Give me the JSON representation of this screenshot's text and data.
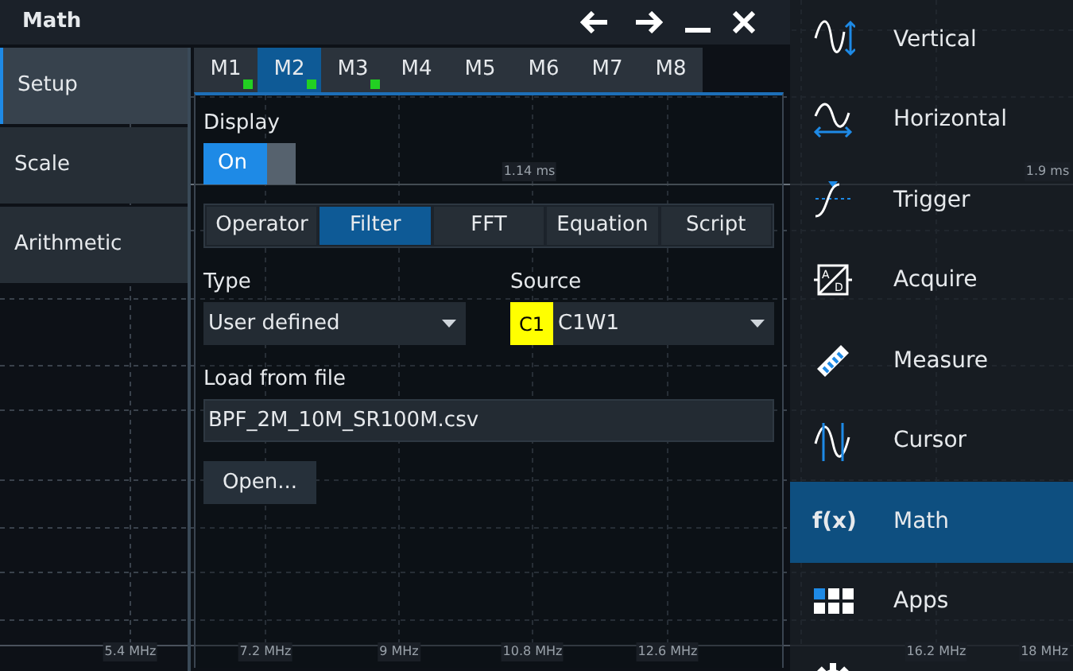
{
  "window": {
    "title": "Math"
  },
  "sidebar": {
    "items": [
      {
        "label": "Setup",
        "selected": true
      },
      {
        "label": "Scale",
        "selected": false
      },
      {
        "label": "Arithmetic",
        "selected": false
      }
    ]
  },
  "math_tabs": [
    {
      "label": "M1",
      "selected": false,
      "active": true
    },
    {
      "label": "M2",
      "selected": true,
      "active": true
    },
    {
      "label": "M3",
      "selected": false,
      "active": true
    },
    {
      "label": "M4",
      "selected": false,
      "active": false
    },
    {
      "label": "M5",
      "selected": false,
      "active": false
    },
    {
      "label": "M6",
      "selected": false,
      "active": false
    },
    {
      "label": "M7",
      "selected": false,
      "active": false
    },
    {
      "label": "M8",
      "selected": false,
      "active": false
    }
  ],
  "display": {
    "label": "Display",
    "toggle": {
      "label": "On",
      "on": true
    }
  },
  "mode_tabs": [
    {
      "label": "Operator",
      "selected": false
    },
    {
      "label": "Filter",
      "selected": true
    },
    {
      "label": "FFT",
      "selected": false
    },
    {
      "label": "Equation",
      "selected": false
    },
    {
      "label": "Script",
      "selected": false
    }
  ],
  "type": {
    "label": "Type",
    "value": "User defined"
  },
  "source": {
    "label": "Source",
    "badge": "C1",
    "color": "#ffff00",
    "value": "C1W1"
  },
  "load_from_file": {
    "label": "Load from file",
    "value": "BPF_2M_10M_SR100M.csv"
  },
  "open_button": "Open...",
  "menu": [
    {
      "kind": "vertical",
      "label": "Vertical",
      "selected": false
    },
    {
      "kind": "horizontal",
      "label": "Horizontal",
      "selected": false
    },
    {
      "kind": "trigger",
      "label": "Trigger",
      "selected": false
    },
    {
      "kind": "acquire",
      "label": "Acquire",
      "icon_letters": [
        "A",
        "D"
      ],
      "selected": false
    },
    {
      "kind": "measure",
      "label": "Measure",
      "selected": false
    },
    {
      "kind": "cursor",
      "label": "Cursor",
      "selected": false
    },
    {
      "kind": "math",
      "label": "Math",
      "icon_text": "f(x)",
      "selected": true
    },
    {
      "kind": "apps",
      "label": "Apps",
      "selected": false
    },
    {
      "kind": "setup",
      "selected": false
    }
  ],
  "axis_labels": {
    "time": [
      "1.14 ms",
      "1.9 ms"
    ],
    "frequency": [
      "5.4 MHz",
      "7.2 MHz",
      "9 MHz",
      "10.8 MHz",
      "12.6 MHz",
      "16.2 MHz",
      "18 MHz"
    ]
  }
}
